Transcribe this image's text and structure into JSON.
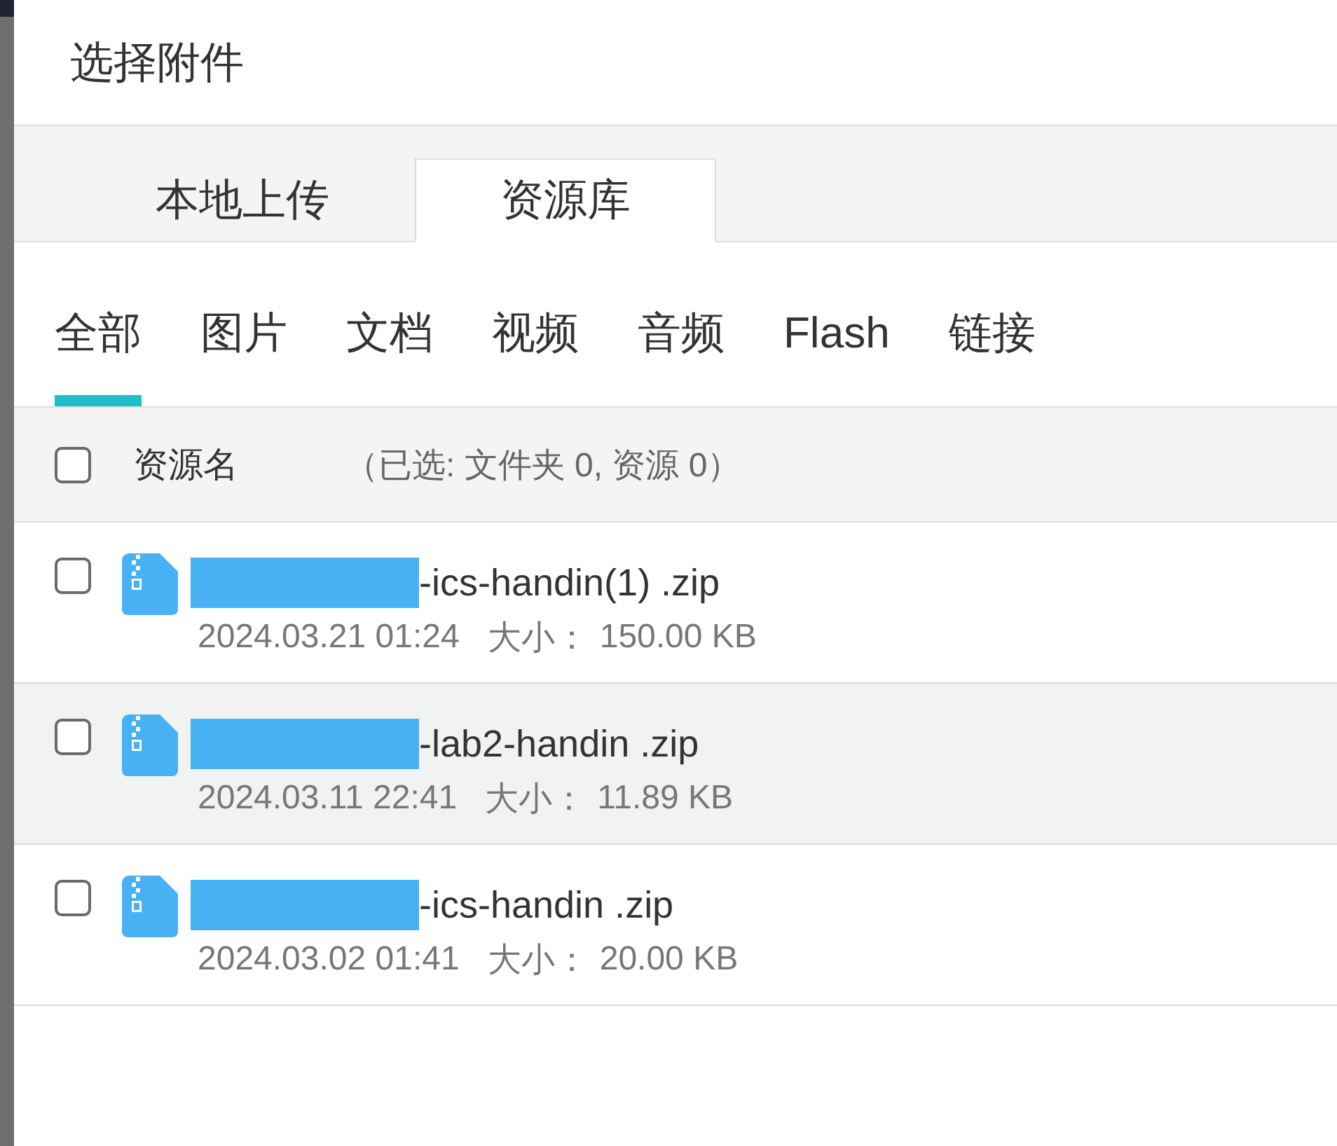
{
  "dialog": {
    "title": "选择附件"
  },
  "tabs": [
    {
      "label": "本地上传",
      "selected": false
    },
    {
      "label": "资源库",
      "selected": true
    }
  ],
  "filters": [
    {
      "label": "全部",
      "selected": true
    },
    {
      "label": "图片",
      "selected": false
    },
    {
      "label": "文档",
      "selected": false
    },
    {
      "label": "视频",
      "selected": false
    },
    {
      "label": "音频",
      "selected": false
    },
    {
      "label": "Flash",
      "selected": false
    },
    {
      "label": "链接",
      "selected": false
    }
  ],
  "table": {
    "select_all": {
      "checked": false
    },
    "column": "资源名",
    "selection_summary": "（已选: 文件夹 0, 资源 0）",
    "rows": [
      {
        "kind": "zip",
        "checked": false,
        "highlighted": false,
        "name_redacted": true,
        "name": "-ics-handin(1) .zip",
        "date": "2024.03.21 01:24",
        "size_label": "大小：",
        "size": "150.00 KB"
      },
      {
        "kind": "zip",
        "checked": false,
        "highlighted": true,
        "name_redacted": true,
        "name": "-lab2-handin .zip",
        "date": "2024.03.11 22:41",
        "size_label": "大小：",
        "size": "11.89 KB"
      },
      {
        "kind": "zip",
        "checked": false,
        "highlighted": false,
        "name_redacted": true,
        "name": "-ics-handin .zip",
        "date": "2024.03.02 01:41",
        "size_label": "大小：",
        "size": "20.00 KB"
      }
    ]
  }
}
